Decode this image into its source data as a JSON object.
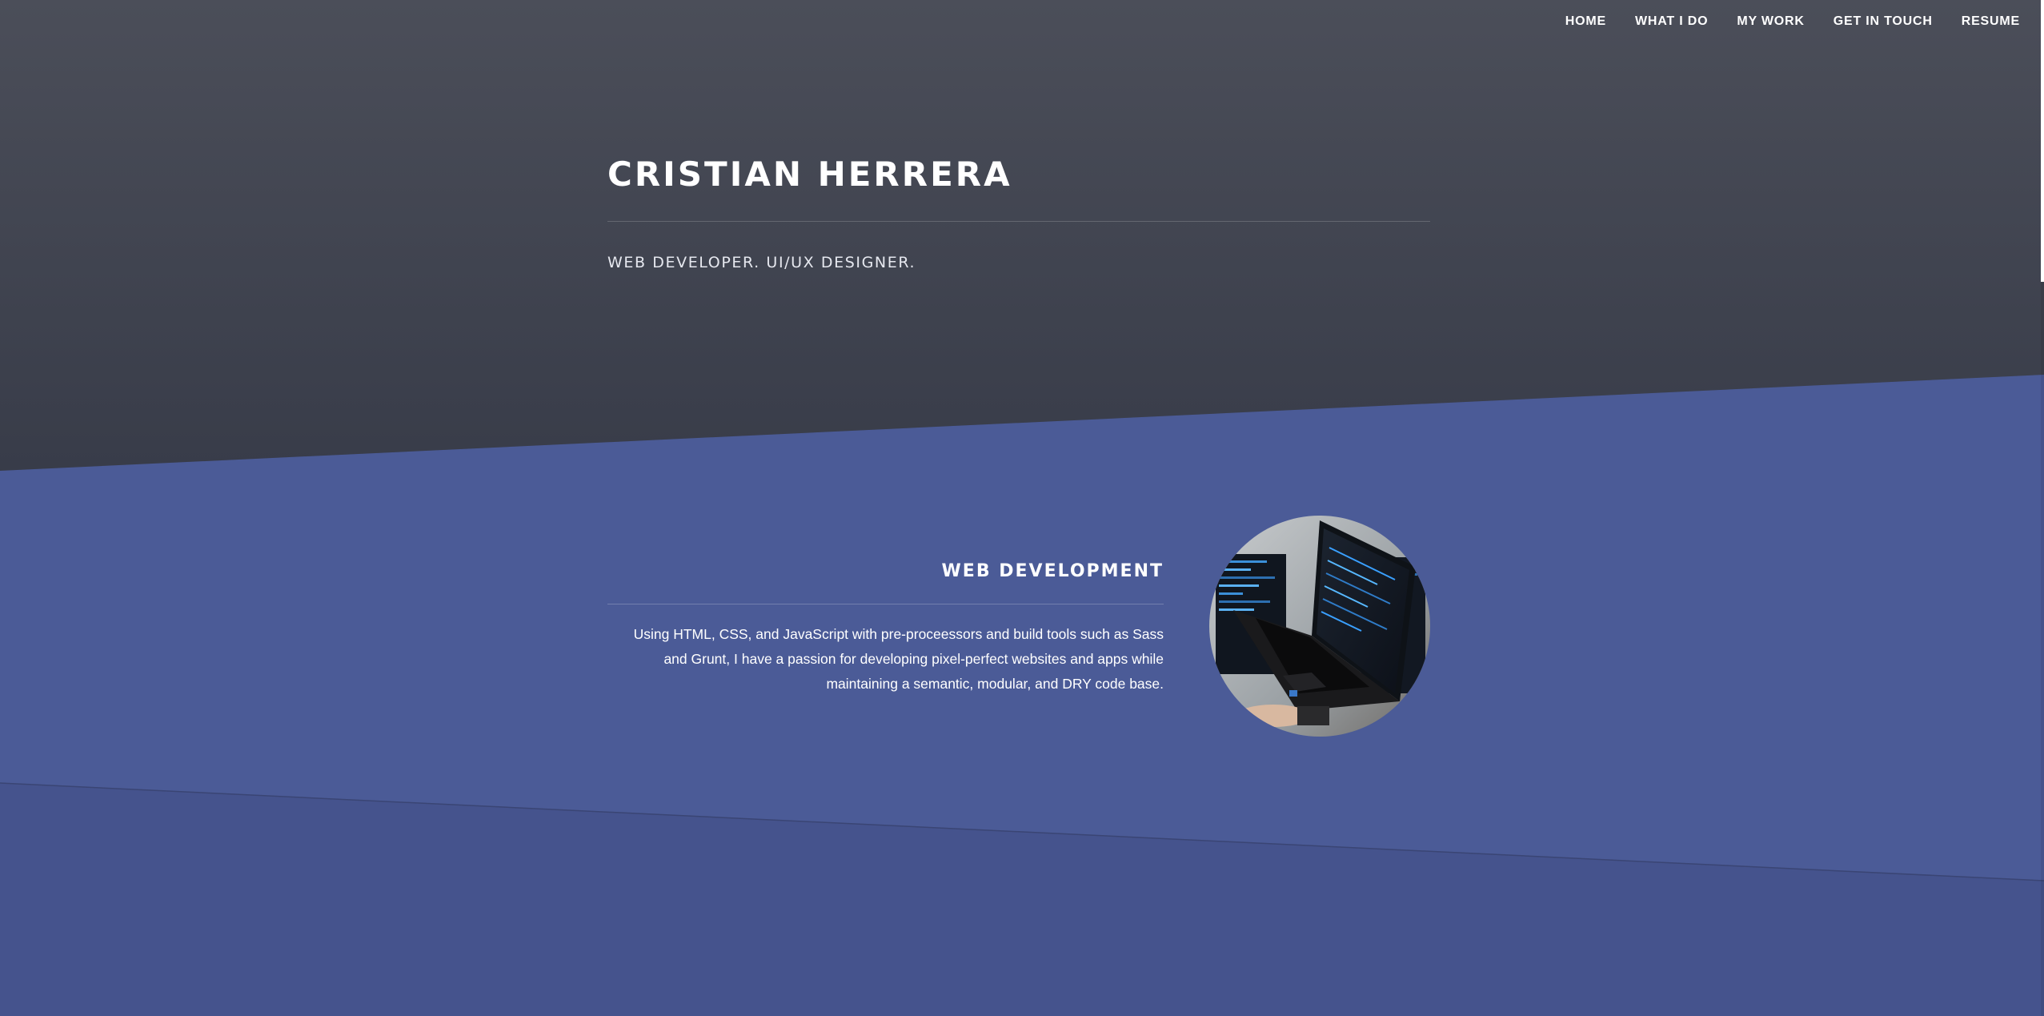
{
  "nav": {
    "items": [
      {
        "label": "HOME"
      },
      {
        "label": "WHAT I DO"
      },
      {
        "label": "MY WORK"
      },
      {
        "label": "GET IN TOUCH"
      },
      {
        "label": "RESUME"
      }
    ]
  },
  "hero": {
    "name": "CRISTIAN HERRERA",
    "subtitle": "WEB DEVELOPER. UI/UX DESIGNER."
  },
  "services": [
    {
      "title": "WEB DEVELOPMENT",
      "description": "Using HTML, CSS, and JavaScript with pre-proceessors and build tools such as Sass and Grunt, I have a passion for developing pixel-perfect websites and apps while maintaining a semantic, modular, and DRY code base.",
      "image_icon": "laptop-photo"
    }
  ],
  "colors": {
    "hero_bg_top": "#4a4d58",
    "hero_bg_bottom": "#393d4a",
    "section_blue": "#4b5b97",
    "section_blue_dark": "#45538d",
    "text": "#ffffff"
  }
}
